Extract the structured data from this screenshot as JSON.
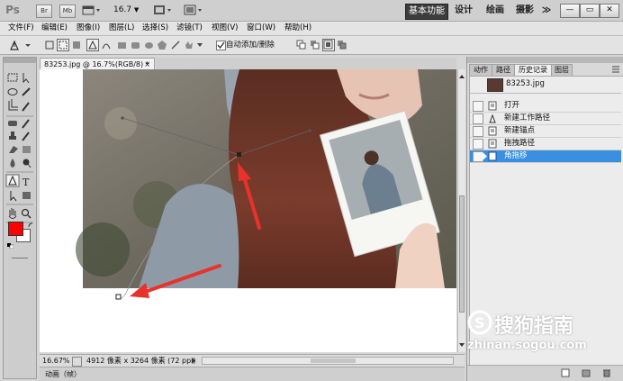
{
  "titlebar": {
    "ps_logo": "Ps",
    "br_btn": "Br",
    "mb_btn": "Mb",
    "zoom_value": "16.7",
    "workspaces": [
      "基本功能",
      "设计",
      "绘画",
      "摄影"
    ],
    "overflow": "≫",
    "minimize": "—",
    "restore": "▭",
    "close": "✕"
  },
  "menu": [
    "文件(F)",
    "编辑(E)",
    "图像(I)",
    "图层(L)",
    "选择(S)",
    "滤镜(T)",
    "视图(V)",
    "窗口(W)",
    "帮助(H)"
  ],
  "options": {
    "auto_add_delete_label": "自动添加/删除"
  },
  "document": {
    "tab_label": "83253.jpg @ 16.7%(RGB/8) *",
    "tab_close": "×"
  },
  "status": {
    "zoom": "16.67%",
    "doc_info": "4912 像素 x 3264 像素 (72 ppi)"
  },
  "bottom_panel": {
    "label": "动画（帧）"
  },
  "right_panel": {
    "tabs": [
      "动作",
      "路径",
      "历史记录",
      "图层"
    ],
    "snapshot_label": "83253.jpg",
    "history_items": [
      "打开",
      "新建工作路径",
      "新建锚点",
      "拖拽路径",
      "角拖移"
    ],
    "active_index": 4
  },
  "watermark": {
    "main": "搜狗指南",
    "url": "zhinan.sogou.com"
  },
  "colors": {
    "foreground": "#ff0000",
    "background": "#ffffff",
    "history_selected": "#3a8fe0",
    "workspace_active": "#3d3d3d",
    "annotation_arrow": "#e8322c"
  }
}
